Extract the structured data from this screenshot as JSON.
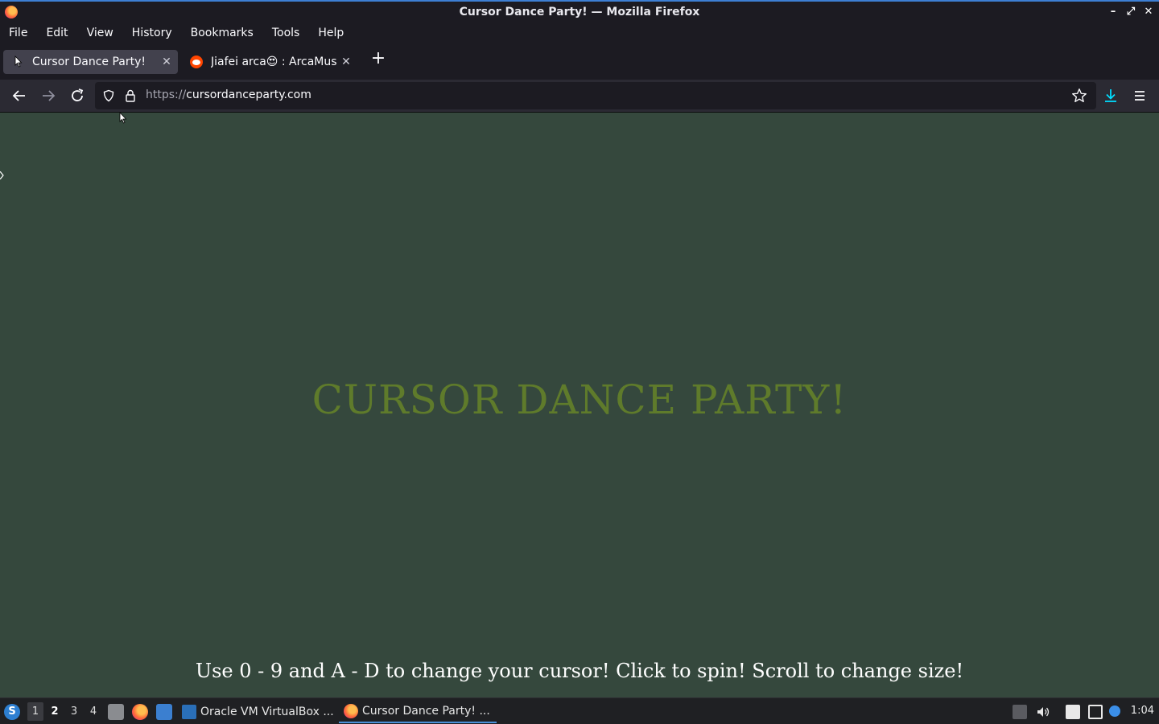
{
  "window": {
    "title": "Cursor Dance Party! — Mozilla Firefox"
  },
  "menubar": {
    "items": [
      "File",
      "Edit",
      "View",
      "History",
      "Bookmarks",
      "Tools",
      "Help"
    ]
  },
  "tabs": [
    {
      "title": "Cursor Dance Party!",
      "active": true,
      "icon": "cursor-icon"
    },
    {
      "title": "Jiafei arca😍 : ArcaMusic",
      "active": false,
      "icon": "reddit-icon"
    }
  ],
  "navbar": {
    "url_scheme": "https://",
    "url_host": "cursordanceparty.com"
  },
  "page": {
    "headline": "CURSOR DANCE PARTY!",
    "instructions": "Use 0 - 9 and A - D to change your cursor! Click to spin! Scroll to change size!",
    "background": "#35483d",
    "headline_color": "#5f7b2b"
  },
  "taskbar": {
    "workspaces": [
      "1",
      "2",
      "3",
      "4"
    ],
    "tasks": [
      {
        "label": "Oracle VM VirtualBox ...",
        "active": false
      },
      {
        "label": "Cursor Dance Party! ...",
        "active": true
      }
    ],
    "clock": "1:04"
  }
}
